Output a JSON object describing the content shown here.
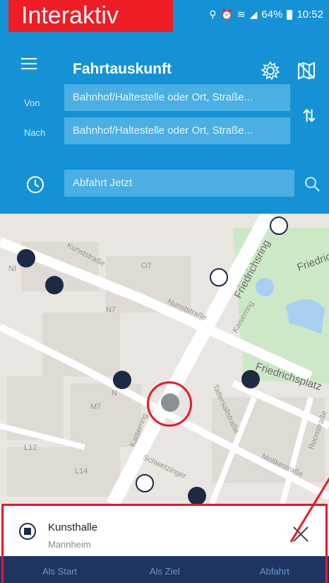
{
  "badge": {
    "label": "Interaktiv"
  },
  "status": {
    "battery": "64%",
    "time": "10:52"
  },
  "header": {
    "title": "Fahrtauskunft",
    "von_label": "Von",
    "nach_label": "Nach",
    "von_placeholder": "Bahnhof/Haltestelle oder Ort, Straße...",
    "nach_placeholder": "Bahnhof/Haltestelle oder Ort, Straße...",
    "time_value": "Abfahrt Jetzt"
  },
  "map": {
    "labels": {
      "kunststrasse": "Kunststraße",
      "nunststrasse": "Nunststraße",
      "friedrichsring": "Friedrichsring",
      "kaiserring_upper": "Kaiserring",
      "kaiserring_lower": "Kaiserring",
      "friedrichsplatz": "Friedrichsplatz",
      "friedrichs": "Friedric",
      "tattersallstrasse": "Tattersallstraße",
      "roonstrasse": "Roonstraße",
      "moltkestrasse": "Moltkestraße",
      "schwetzinger": "Schwetzinger",
      "o7": "O7",
      "n7": "N7",
      "m7": "M7",
      "l12": "L12",
      "l14": "L14",
      "n_small": "N",
      "ni": "NI"
    }
  },
  "stop": {
    "name": "Kunsthalle",
    "city": "Mannheim"
  },
  "actions": {
    "start": "Als Start",
    "ziel": "Als Ziel",
    "abfahrt": "Abfahrt"
  },
  "colors": {
    "primary": "#1592d6",
    "highlight": "#e8182b",
    "actionbar": "#1d3560"
  }
}
